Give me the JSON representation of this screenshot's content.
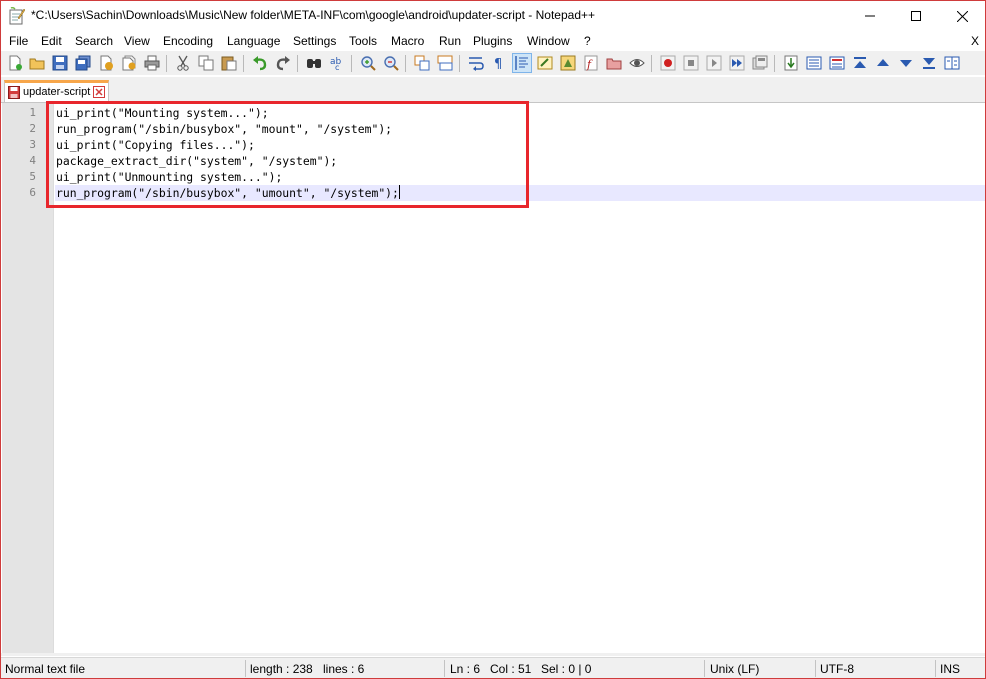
{
  "window": {
    "title": "*C:\\Users\\Sachin\\Downloads\\Music\\New folder\\META-INF\\com\\google\\android\\updater-script - Notepad++"
  },
  "menu": {
    "items": [
      "File",
      "Edit",
      "Search",
      "View",
      "Encoding",
      "Language",
      "Settings",
      "Tools",
      "Macro",
      "Run",
      "Plugins",
      "Window",
      "?"
    ],
    "close_label": "X"
  },
  "toolbar": {
    "buttons": [
      "new-file-icon",
      "open-file-icon",
      "save-icon",
      "save-all-icon",
      "close-icon",
      "close-all-icon",
      "print-icon",
      "cut-icon",
      "copy-icon",
      "paste-icon",
      "undo-icon",
      "redo-icon",
      "find-icon",
      "replace-icon",
      "zoom-in-icon",
      "zoom-out-icon",
      "sync-vertical-icon",
      "sync-horizontal-icon",
      "word-wrap-icon",
      "show-all-characters-icon",
      "indent-guide-icon",
      "user-defined-language-icon",
      "document-map-icon",
      "function-list-icon",
      "folder-as-workspace-icon",
      "monitoring-icon",
      "record-macro-icon",
      "stop-recording-icon",
      "play-macro-icon",
      "run-macro-multiple-icon",
      "save-macro-icon",
      "compare-icon",
      "clear-results-icon",
      "navigate-first-icon",
      "navigate-previous-icon",
      "navigate-next-icon",
      "navigate-last-icon",
      "settings-panel-icon"
    ]
  },
  "tab": {
    "label": "updater-script",
    "modified_color": "#d33b3b"
  },
  "editor": {
    "line_numbers": [
      "1",
      "2",
      "3",
      "4",
      "5",
      "6"
    ],
    "lines": [
      "ui_print(\"Mounting system...\");",
      "run_program(\"/sbin/busybox\", \"mount\", \"/system\");",
      "ui_print(\"Copying files...\");",
      "package_extract_dir(\"system\", \"/system\");",
      "ui_print(\"Unmounting system...\");",
      "run_program(\"/sbin/busybox\", \"umount\", \"/system\");"
    ],
    "current_line_index": 5,
    "highlight_color": "#e8262c",
    "current_line_color": "#e8e8ff"
  },
  "status": {
    "file_type": "Normal text file",
    "length": "length : 238",
    "lines": "lines : 6",
    "ln": "Ln : 6",
    "col": "Col : 51",
    "sel": "Sel : 0 | 0",
    "eol": "Unix (LF)",
    "encoding": "UTF-8",
    "mode": "INS"
  }
}
